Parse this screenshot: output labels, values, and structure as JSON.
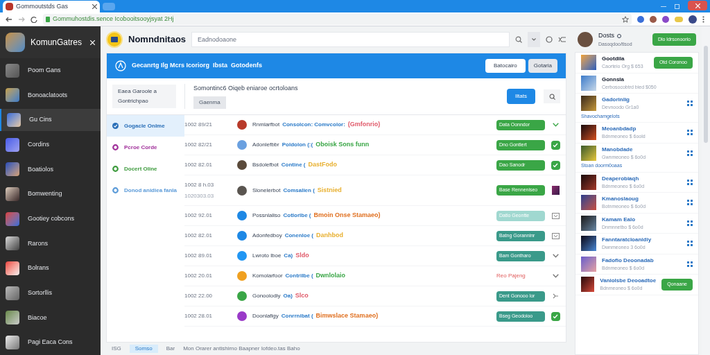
{
  "browser": {
    "tab_title": "Gommoutstds Gas",
    "url": "Gommuhostdis.sence Icobooitsooyjsyat 2Hj"
  },
  "sidebar": {
    "title": "KomunGatres",
    "items": [
      {
        "label": "Poom Gans",
        "selected": false
      },
      {
        "label": "Bonoaclatoots",
        "selected": false
      },
      {
        "label": "Gu Cins",
        "selected": true
      },
      {
        "label": "Cordins",
        "selected": false
      },
      {
        "label": "Boatiolos",
        "selected": false
      },
      {
        "label": "Bomwenting",
        "selected": false
      },
      {
        "label": "Gootiey cobcons",
        "selected": false
      },
      {
        "label": "Rarons",
        "selected": false
      },
      {
        "label": "Bolrans",
        "selected": false
      },
      {
        "label": "Sortorllis",
        "selected": false
      },
      {
        "label": "Biacoe",
        "selected": false
      },
      {
        "label": "Pagi Eaca Cons",
        "selected": false
      }
    ]
  },
  "header": {
    "title": "Nomndnitaos",
    "search_placeholder": "Eadnodoaone"
  },
  "banner": {
    "text": "Gecanrtg Ilg Mcrs Icoriorg  Ibsta  Gotodenfs",
    "buttons": [
      "Batocairo",
      "Gotaria"
    ]
  },
  "filter": {
    "box_lines": [
      "Eaea Garoole a",
      "Gontrichpao"
    ],
    "description": "Somontinc6 Oiqeb eniaroe ocrtoloans",
    "reset_button": "Gaenma",
    "apply_button": "Iltats"
  },
  "status_filters": [
    {
      "label": "Gogacle Onlme",
      "color": "#2a6fb8",
      "selected": true
    },
    {
      "label": "Pcroe Corde",
      "color": "#a0309a",
      "selected": false
    },
    {
      "label": "Docert Oline",
      "color": "#3c9a3c",
      "selected": false
    },
    {
      "label": "Donod anidiea fanla",
      "color": "#5a9ad8",
      "selected": false
    }
  ],
  "rows": [
    {
      "time": "1002 89/21",
      "name": "Rnmlarfbot",
      "detail": "Consolcon: Comvcolor:",
      "tag": "(Gmfonrio)",
      "color": "#e05a6a",
      "action": {
        "kind": "primary",
        "label": "Data Oonndor"
      },
      "status": {
        "kind": "chevron"
      }
    },
    {
      "time": "1002 82/21",
      "name": "Adonlefbbr",
      "detail": "Poldolon (:(",
      "tag": "Oboisk Sons funn",
      "color": "#3aa646",
      "action": {
        "kind": "primary",
        "label": "Dno Gontlert"
      },
      "status": {
        "kind": "checkbox",
        "checked": true
      }
    },
    {
      "time": "1002 82.01",
      "name": "Bsdolefbot",
      "detail": "Contine (",
      "tag": "DastFodo",
      "color": "#e8b030",
      "action": {
        "kind": "primary",
        "label": "Dao Sanodr"
      },
      "status": {
        "kind": "checkbox",
        "checked": true
      }
    },
    {
      "time": "1002 8 h.03",
      "extra_time": "1020303.03",
      "name": "Slonelerbot",
      "detail": "Comsalien (",
      "tag": "Sistnied",
      "color": "#e8b030",
      "action": {
        "kind": "primary",
        "label": "Base Renneniseo"
      },
      "status": {
        "kind": "picture"
      }
    },
    {
      "time": "1002 92.01",
      "name": "Possnlaliso",
      "detail": "Cotlorlbe (",
      "tag": "Bmoin Onse Stamaeo)",
      "color": "#e07020",
      "action": {
        "kind": "faded",
        "label": "Datio Geontte"
      },
      "status": {
        "kind": "window"
      }
    },
    {
      "time": "1002 82.01",
      "name": "Adonfedboy",
      "detail": "Conenloe (",
      "tag": "Danhbod",
      "color": "#e8b030",
      "action": {
        "kind": "secondary",
        "label": "Batng Goranninr"
      },
      "status": {
        "kind": "window"
      }
    },
    {
      "time": "1002 89.01",
      "name": "Lwroto lboe",
      "detail": "Ca)",
      "tag": "Sldo",
      "color": "#e05a6a",
      "action": {
        "kind": "secondary",
        "label": "Bam Gontharo"
      },
      "status": {
        "kind": "chevron"
      }
    },
    {
      "time": "1002 20.01",
      "name": "Komolarfoor",
      "detail": "Contrilbe (",
      "tag": "Dwnlolaio",
      "color": "#3aa646",
      "action": {
        "kind": "text",
        "label": "Reo Pajeng"
      },
      "status": {
        "kind": "chevron"
      }
    },
    {
      "time": "1002 22.00",
      "name": "Gonoolodiy",
      "detail": "Oa)",
      "tag": "Slco",
      "color": "#e05a6a",
      "action": {
        "kind": "secondary",
        "label": "Dent Gonooo lor"
      },
      "status": {
        "kind": "collapse"
      }
    },
    {
      "time": "1002 28.01",
      "name": "Doonlafigy",
      "detail": "Conrrnibat (",
      "tag": "Bimwslace Stamaeo)",
      "color": "#e07020",
      "action": {
        "kind": "secondary",
        "label": "Bseg Geodoioo"
      },
      "status": {
        "kind": "checkbox",
        "checked": true
      }
    }
  ],
  "footer": {
    "items": [
      {
        "label": "ISG",
        "selected": false
      },
      {
        "label": "Somso",
        "selected": true
      },
      {
        "label": "Bar",
        "selected": false
      },
      {
        "label": "Mon Orarer antishirno Baapner Iofdeo.tas Baho",
        "selected": false
      }
    ]
  },
  "profile": {
    "name": "Dosts",
    "subtitle": "Dasoqdoo/tlsod",
    "button": "Dlo ldrsonoorio"
  },
  "cards": [
    {
      "kind": "button",
      "title": "Gootdila",
      "subtitle": "Caorteio Org $ 653",
      "button": "Otd Coronoo"
    },
    {
      "kind": "plain",
      "title": "Gonnsla",
      "subtitle": "Cerbosocobtrd bied $050"
    },
    {
      "kind": "dots",
      "title": "Gadorinlig",
      "subtitle": "Devnoodo Gr1a0",
      "link": "Shavochamgelots"
    },
    {
      "kind": "dots",
      "title": "Meoanbdadp",
      "subtitle": "Bdnmeoneo $ 6oold"
    },
    {
      "kind": "dots",
      "title": "Manobdade",
      "subtitle": "Gwnmeoneo $ 6o0d",
      "link": "Stoan doorm0oaas"
    },
    {
      "kind": "dots",
      "title": "Deaperobiaqh",
      "subtitle": "Bdnmeoneo $ 6o0d"
    },
    {
      "kind": "dots",
      "title": "Kmanoslaoug",
      "subtitle": "Botnmeoneo $ 6o0d"
    },
    {
      "kind": "dots",
      "title": "Kamam Ealo",
      "subtitle": "Dnmnnetbo $ 6o0d"
    },
    {
      "kind": "dots",
      "title": "Fanntaratcloanidiy",
      "subtitle": "Dwnmeoneo 3 6o0d"
    },
    {
      "kind": "dots",
      "title": "Fadofio Deoonadab",
      "subtitle": "Bdnmeoneo $ 6o0d"
    },
    {
      "kind": "button",
      "title": "Vaniolsbe Deooadtoe",
      "subtitle": "Bdnmeoneo $ 6o0d",
      "button": "Qonaane"
    }
  ]
}
